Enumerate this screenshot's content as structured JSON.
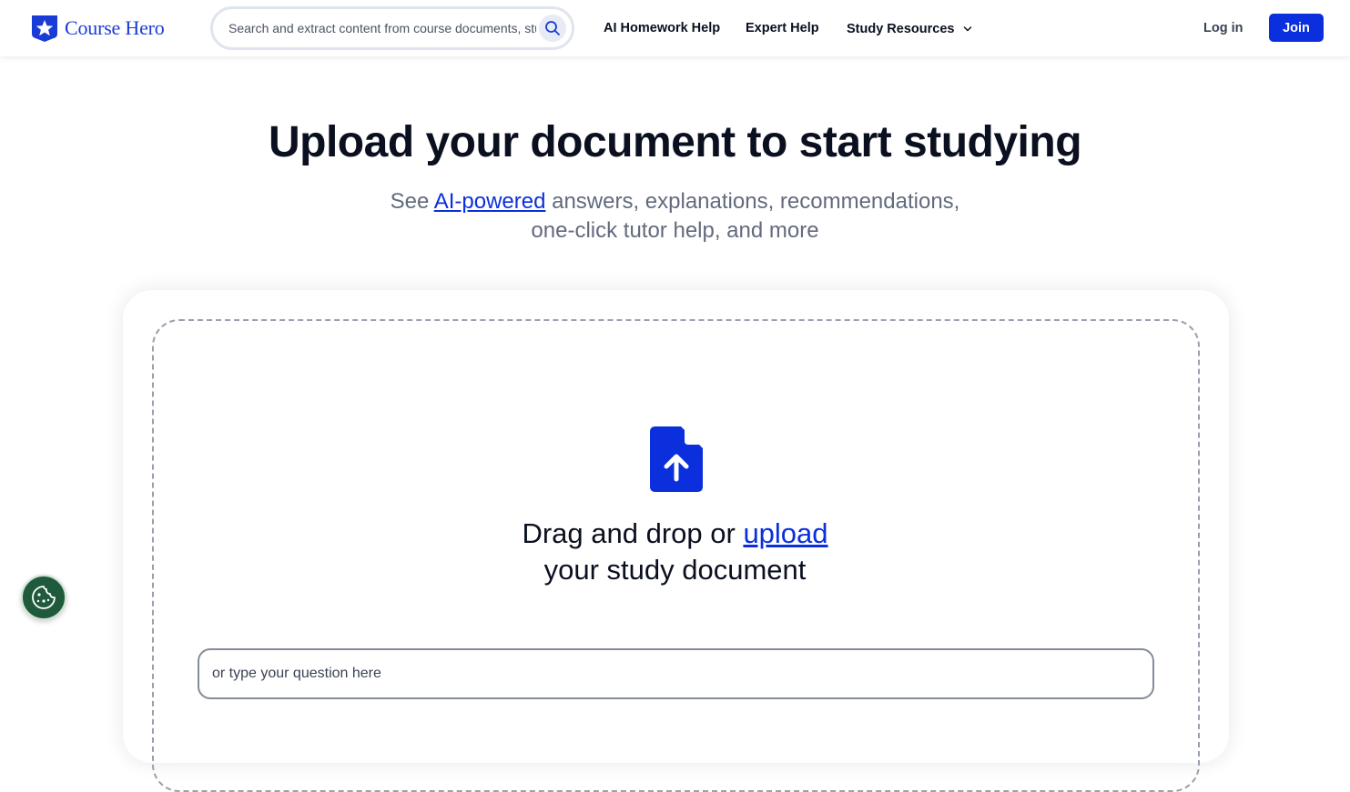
{
  "brand": {
    "name": "Course Hero",
    "color": "#1a3bd6"
  },
  "header": {
    "search_placeholder": "Search and extract content from course documents, study resources, and more",
    "nav": {
      "homework_help": "AI Homework Help",
      "expert_help": "Expert Help",
      "study_resources": "Study Resources"
    },
    "login": "Log in",
    "join": "Join"
  },
  "hero": {
    "title": "Upload your document to start studying",
    "subtitle_prefix": "See ",
    "subtitle_link": "AI-powered",
    "subtitle_line1_rest": " answers, explanations, recommendations,",
    "subtitle_line2": "one-click tutor help, and more"
  },
  "upload": {
    "drag_prefix": "Drag and drop or ",
    "upload_link": "upload",
    "drag_line2": "your study document",
    "question_placeholder": "or type your question here"
  },
  "colors": {
    "accent": "#0b2fdc",
    "cookie_bg": "#1f5a3c",
    "muted_text": "#626a7d"
  },
  "icons": {
    "logo": "star-shield-icon",
    "search": "search-icon",
    "dropdown": "chevron-down-icon",
    "upload": "file-upload-icon",
    "cookie": "cookie-icon"
  }
}
